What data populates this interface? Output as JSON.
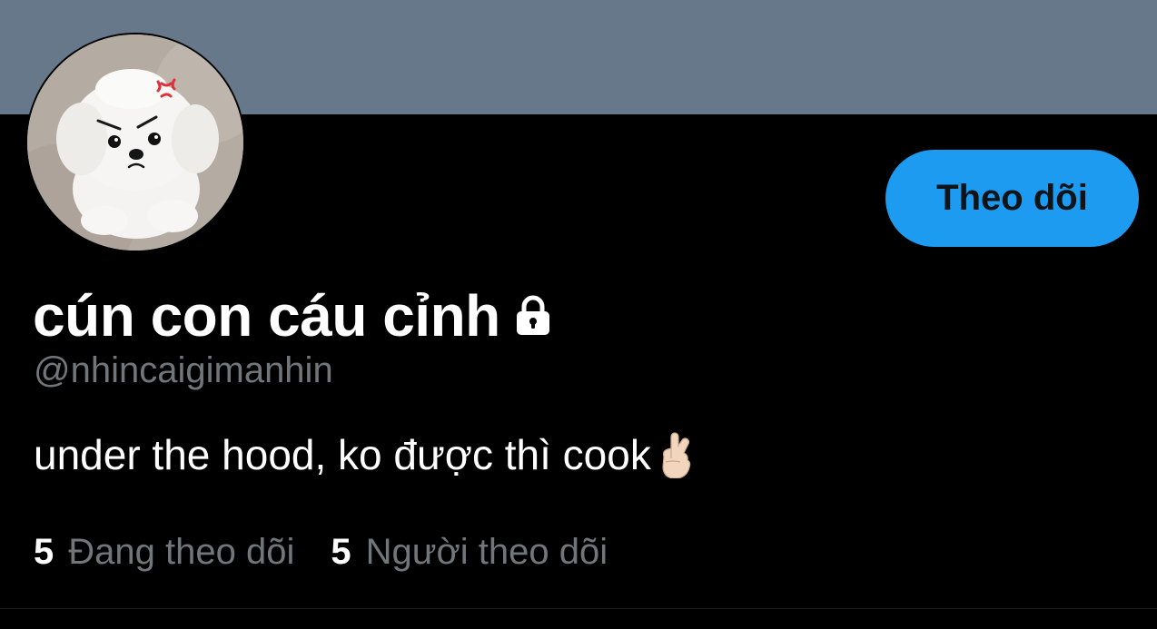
{
  "profile": {
    "display_name": "cún con cáu cỉnh",
    "handle": "@nhincaigimanhin",
    "bio": "under the hood, ko được thì cook",
    "bio_emoji": "crossed-fingers-icon",
    "locked_icon": "lock-icon",
    "avatar_icon": "avatar-puppy-icon"
  },
  "actions": {
    "follow_label": "Theo dõi"
  },
  "stats": [
    {
      "count": "5",
      "label": "Đang theo dõi"
    },
    {
      "count": "5",
      "label": "Người theo dõi"
    }
  ],
  "colors": {
    "banner": "#66788a",
    "accent": "#1d9bf0",
    "background": "#000000",
    "secondary_text": "#71767b"
  }
}
